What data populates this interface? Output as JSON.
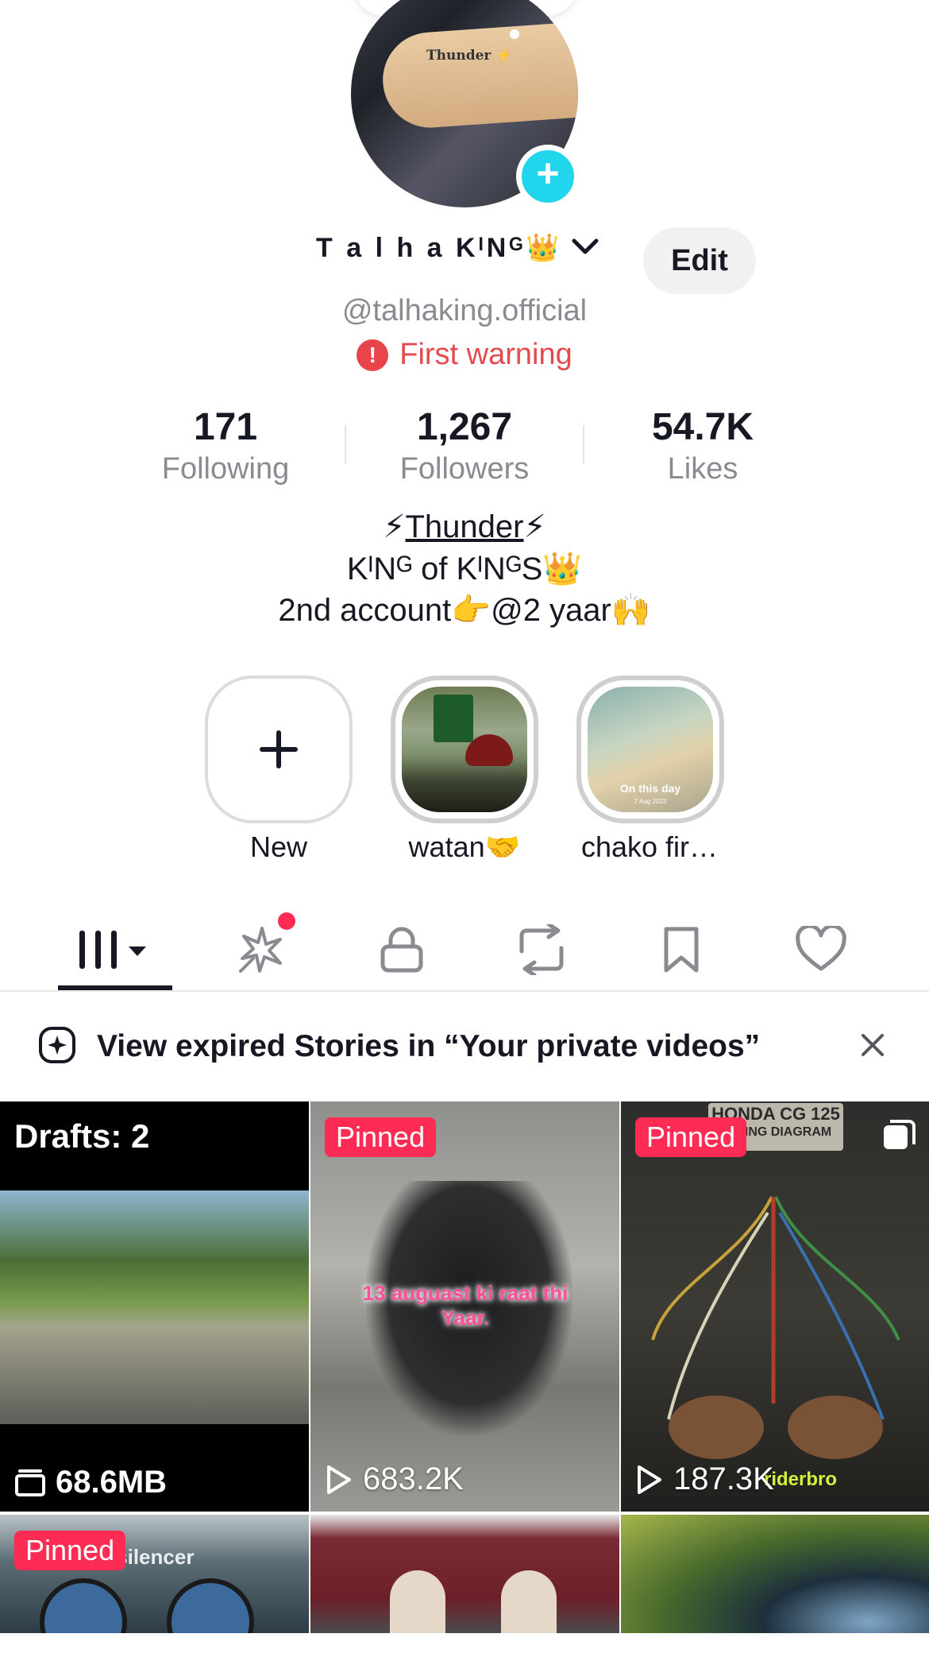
{
  "profile": {
    "display_name": "T a l h a  KᴵNᴳ👑",
    "handle": "@talhaking.official",
    "warning_text": "First warning",
    "edit_label": "Edit",
    "avatar_tattoo_text": "Thunder ⚡"
  },
  "stats": [
    {
      "value": "171",
      "label": "Following"
    },
    {
      "value": "1,267",
      "label": "Followers"
    },
    {
      "value": "54.7K",
      "label": "Likes"
    }
  ],
  "bio": {
    "line1_prefix": "⚡",
    "line1_text": "Thunder",
    "line1_suffix": "⚡",
    "line2": "KᴵNᴳ of  KᴵNᴳS👑",
    "line3": "2nd account👉@2 yaar🙌"
  },
  "stories": [
    {
      "label": "New"
    },
    {
      "label": "watan🤝"
    },
    {
      "label": "chako fir…",
      "overlay": "On this day",
      "overlay_sub": "7 Aug 2023"
    }
  ],
  "banner": {
    "text": "View expired Stories in “Your private videos”"
  },
  "grid": [
    {
      "type": "drafts",
      "title": "Drafts: 2",
      "footer": "68.6MB"
    },
    {
      "type": "video",
      "badge": "Pinned",
      "caption": "13 auguast ki raat thi Yaar.",
      "views": "683.2K"
    },
    {
      "type": "video",
      "badge": "Pinned",
      "poster_title": "HONDA CG 125",
      "poster_sub": "WIRING DIAGRAM",
      "views": "187.3K",
      "watermark": "riderbro"
    },
    {
      "type": "video",
      "badge": "Pinned",
      "poster_title": "ss silencer"
    },
    {
      "type": "video"
    },
    {
      "type": "video"
    }
  ],
  "colors": {
    "accent_pink": "#fe2c55",
    "plus_cyan": "#20d5ec",
    "warning_red": "#e34b4f"
  }
}
